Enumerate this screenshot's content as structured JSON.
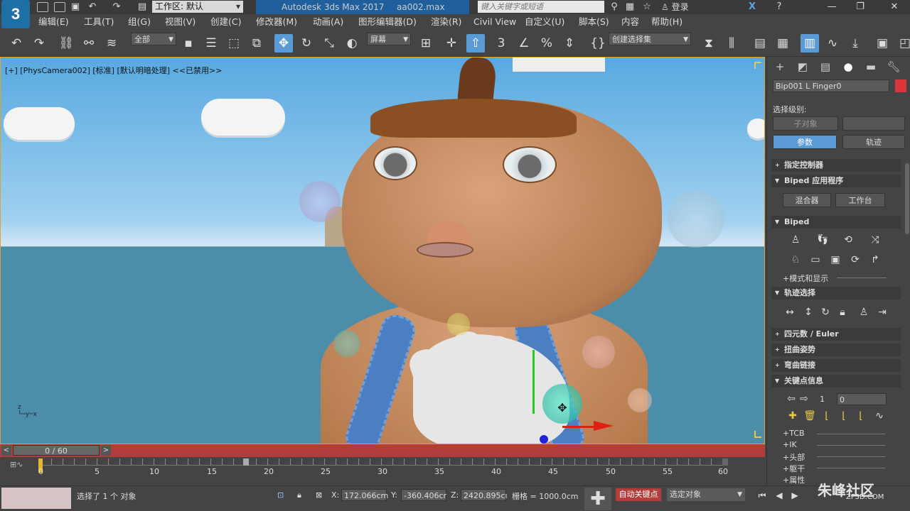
{
  "titlebar": {
    "logo_text": "3",
    "workspace": "工作区: 默认",
    "app_title": "Autodesk 3ds Max 2017",
    "file_name": "aa002.max",
    "search_placeholder": "键入关键字或短语",
    "login": "登录"
  },
  "menu": [
    "编辑(E)",
    "工具(T)",
    "组(G)",
    "视图(V)",
    "创建(C)",
    "修改器(M)",
    "动画(A)",
    "图形编辑器(D)",
    "渲染(R)",
    "Civil View",
    "自定义(U)",
    "脚本(S)",
    "内容",
    "帮助(H)"
  ],
  "toolbar": {
    "filter_dropdown": "全部",
    "coord_dropdown": "屏幕",
    "selection_set": "创建选择集"
  },
  "viewport": {
    "label": "[+] [PhysCamera002] [标准] [默认明暗处理] <<已禁用>>"
  },
  "timeline": {
    "frame_readout": "0 / 60",
    "current_frame": 0,
    "total_frames": 60,
    "ticks": [
      "0",
      "5",
      "10",
      "15",
      "20",
      "25",
      "30",
      "35",
      "40",
      "45",
      "50",
      "55",
      "60"
    ]
  },
  "status": {
    "message": "选择了 1 个 对象",
    "x_label": "X:",
    "x_value": "172.066cm",
    "y_label": "Y:",
    "y_value": "-360.406cr",
    "z_label": "Z:",
    "z_value": "2420.895cı",
    "grid": "栅格 = 1000.0cm",
    "auto_key": "自动关键点",
    "selected_dropdown": "选定对象"
  },
  "command_panel": {
    "object_name": "Bip001 L Finger0",
    "object_color": "#d9353b",
    "selection_level_label": "选择级别:",
    "sub_object_button": "子对象",
    "params_button": "参数",
    "track_button": "轨迹",
    "rollouts": {
      "assign_controller": "指定控制器",
      "biped_apps": "Biped 应用程序",
      "biped": "Biped",
      "track_selection": "轨迹选择",
      "quaternion": "四元数 / Euler",
      "twist_poses": "扭曲姿势",
      "bend_links": "弯曲链接",
      "key_info": "关键点信息"
    },
    "mixer_button": "混合器",
    "workbench_button": "工作台",
    "mode_display": "+模式和显示",
    "key_number": "1",
    "key_value": "0",
    "sub_rollouts": [
      "+TCB",
      "+IK",
      "+头部",
      "+躯干",
      "+属性"
    ]
  },
  "watermark": {
    "text": "朱峰社区",
    "sub": "ZF3D.COM"
  }
}
